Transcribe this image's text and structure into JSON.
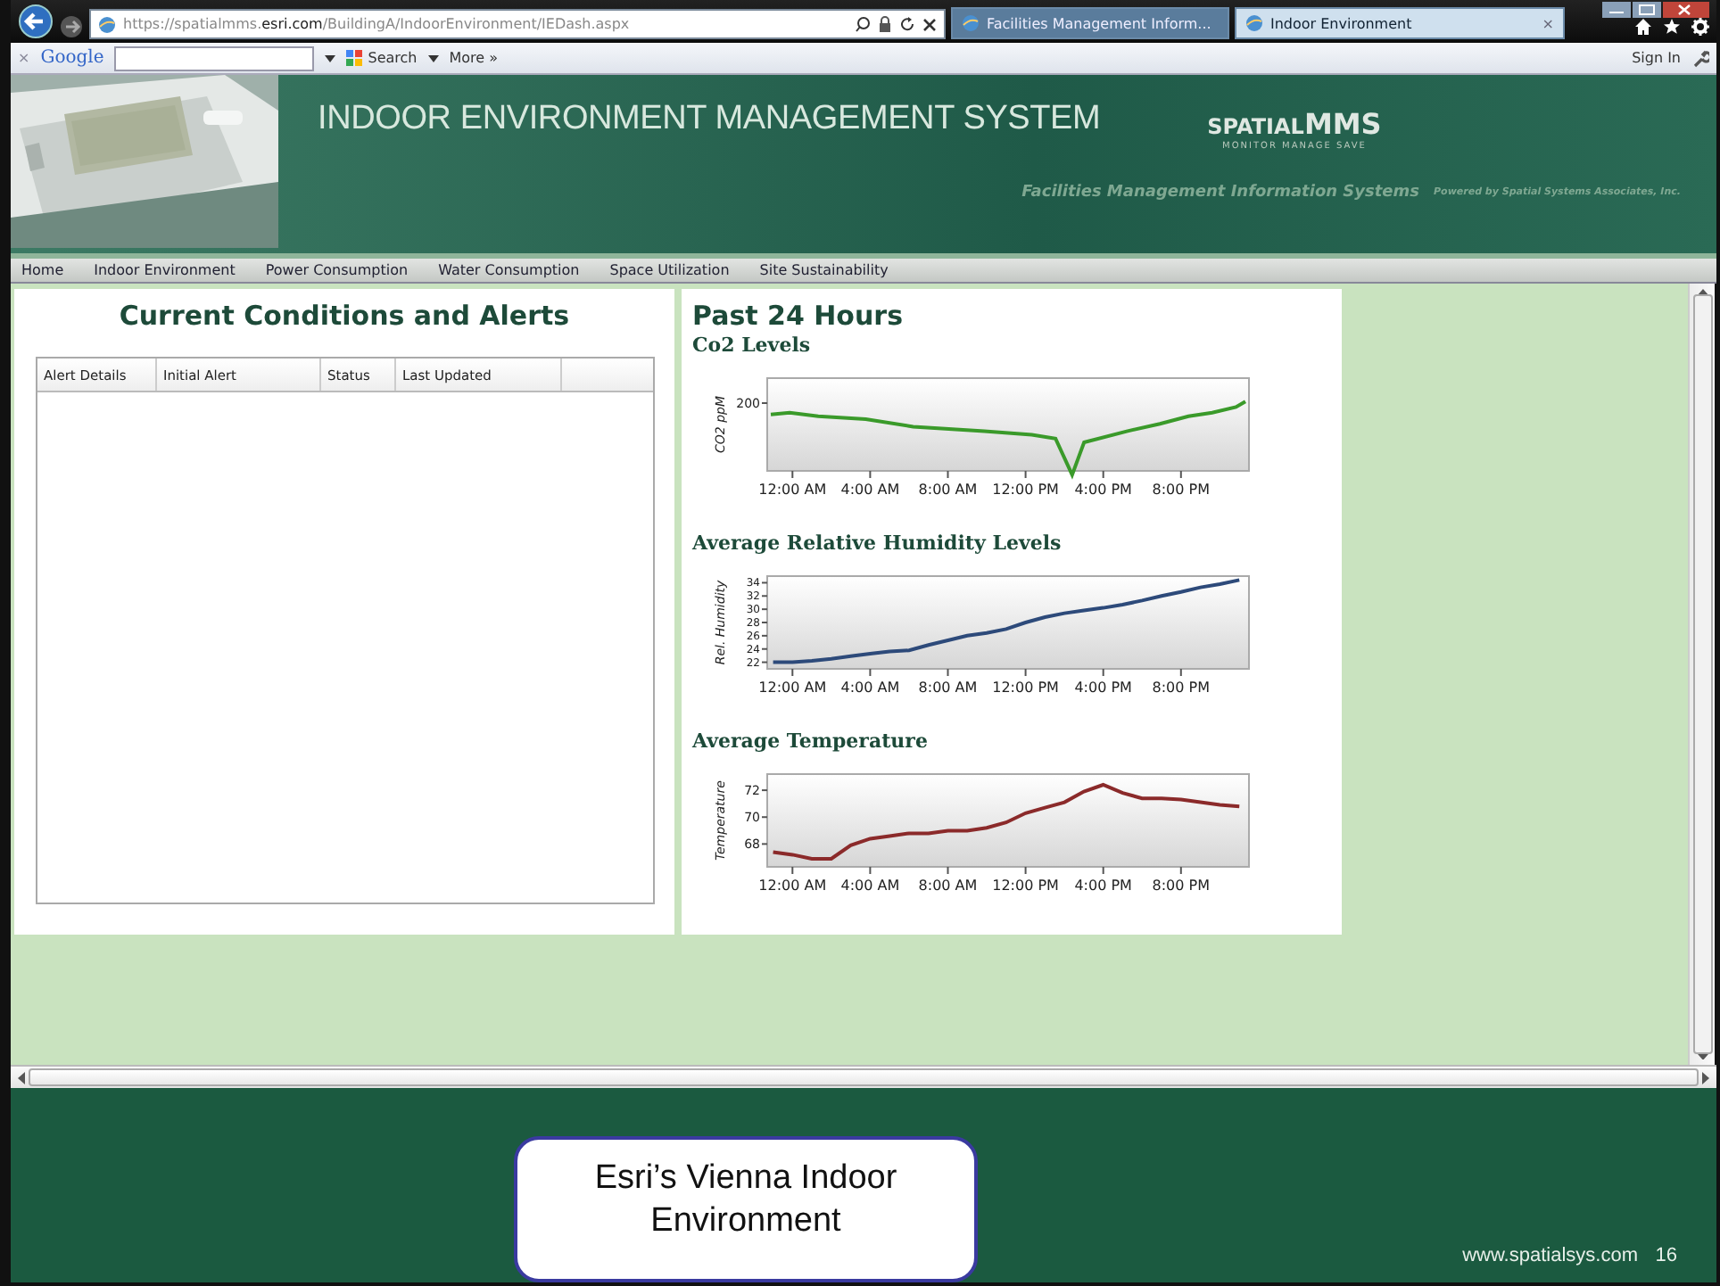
{
  "browser": {
    "address": "https://spatialmms.**esri.com**/BuildingA/IndoorEnvironment/IEDash.aspx",
    "tabs": [
      {
        "label": "Facilities Management Inform...",
        "selected": false
      },
      {
        "label": "Indoor Environment",
        "selected": true,
        "close": "×"
      }
    ]
  },
  "google_toolbar": {
    "close": "×",
    "logo": "Google",
    "search": "Search",
    "more": "More »",
    "sign_in": "Sign In"
  },
  "banner": {
    "title": "INDOOR ENVIRONMENT MANAGEMENT SYSTEM",
    "subtitle": "Facilities Management Information Systems",
    "powered_by": "Powered by Spatial Systems Associates, Inc.",
    "logo_prefix": "SPATIAL",
    "logo_main": "MMS",
    "logo_tagline": "MONITOR MANAGE SAVE"
  },
  "nav": [
    "Home",
    "Indoor Environment",
    "Power Consumption",
    "Water Consumption",
    "Space Utilization",
    "Site Sustainability"
  ],
  "alerts": {
    "title": "Current Conditions and Alerts",
    "columns": [
      "Alert Details",
      "Initial Alert",
      "Status",
      "Last Updated"
    ]
  },
  "charts_panel": {
    "title": "Past 24 Hours",
    "charts": [
      {
        "kind": "sketch",
        "title": "Co2 Levels",
        "ylabel": "CO2 ppM",
        "ytick": "200",
        "xticks": [
          "12:00 AM",
          "4:00 AM",
          "8:00 AM",
          "12:00 PM",
          "4:00 PM",
          "8:00 PM"
        ]
      },
      {
        "kind": "data",
        "title": "Average Relative Humidity Levels",
        "chart_data": {
          "type": "line",
          "ylabel": "Rel. Humidity",
          "x": [
            -1,
            0,
            1,
            2,
            3,
            4,
            5,
            6,
            7,
            8,
            9,
            10,
            11,
            12,
            13,
            14,
            15,
            16,
            17,
            18,
            19,
            20,
            21,
            22,
            23
          ],
          "series": [
            {
              "color": "#2d4a7a",
              "values": [
                22,
                22,
                22.2,
                22.5,
                22.9,
                23.3,
                23.6,
                23.8,
                24.6,
                25.3,
                26,
                26.4,
                27,
                28,
                28.8,
                29.4,
                29.8,
                30.2,
                30.7,
                31.3,
                32,
                32.6,
                33.3,
                33.8,
                34.4
              ]
            }
          ],
          "xlim": [
            -1.3,
            23.5
          ],
          "ylim": [
            21,
            35
          ],
          "yticks": [
            22,
            24,
            26,
            28,
            30,
            32,
            34
          ],
          "xticks": [
            {
              "value": 0,
              "label": "12:00 AM"
            },
            {
              "value": 4,
              "label": "4:00 AM"
            },
            {
              "value": 8,
              "label": "8:00 AM"
            },
            {
              "value": 12,
              "label": "12:00 PM"
            },
            {
              "value": 16,
              "label": "4:00 PM"
            },
            {
              "value": 20,
              "label": "8:00 PM"
            }
          ]
        }
      },
      {
        "kind": "data",
        "title": "Average Temperature",
        "chart_data": {
          "type": "line",
          "ylabel": "Temperature",
          "x": [
            -1,
            0,
            1,
            2,
            3,
            4,
            5,
            6,
            7,
            8,
            9,
            10,
            11,
            12,
            13,
            14,
            15,
            16,
            17,
            18,
            19,
            20,
            21,
            22,
            23
          ],
          "series": [
            {
              "color": "#8b2a2a",
              "values": [
                67.4,
                67.2,
                66.9,
                66.9,
                67.9,
                68.4,
                68.6,
                68.8,
                68.8,
                69,
                69,
                69.2,
                69.6,
                70.3,
                70.7,
                71.1,
                71.9,
                72.4,
                71.8,
                71.4,
                71.4,
                71.3,
                71.1,
                70.9,
                70.8
              ]
            }
          ],
          "xlim": [
            -1.3,
            23.5
          ],
          "ylim": [
            66.3,
            73.2
          ],
          "yticks": [
            68,
            70,
            72
          ],
          "xticks": [
            {
              "value": 0,
              "label": "12:00 AM"
            },
            {
              "value": 4,
              "label": "4:00 AM"
            },
            {
              "value": 8,
              "label": "8:00 AM"
            },
            {
              "value": 12,
              "label": "12:00 PM"
            },
            {
              "value": 16,
              "label": "4:00 PM"
            },
            {
              "value": 20,
              "label": "8:00 PM"
            }
          ]
        }
      }
    ]
  },
  "slide": {
    "caption": "Esri’s Vienna Indoor Environment",
    "site": "www.spatialsys.com",
    "page": "16"
  }
}
